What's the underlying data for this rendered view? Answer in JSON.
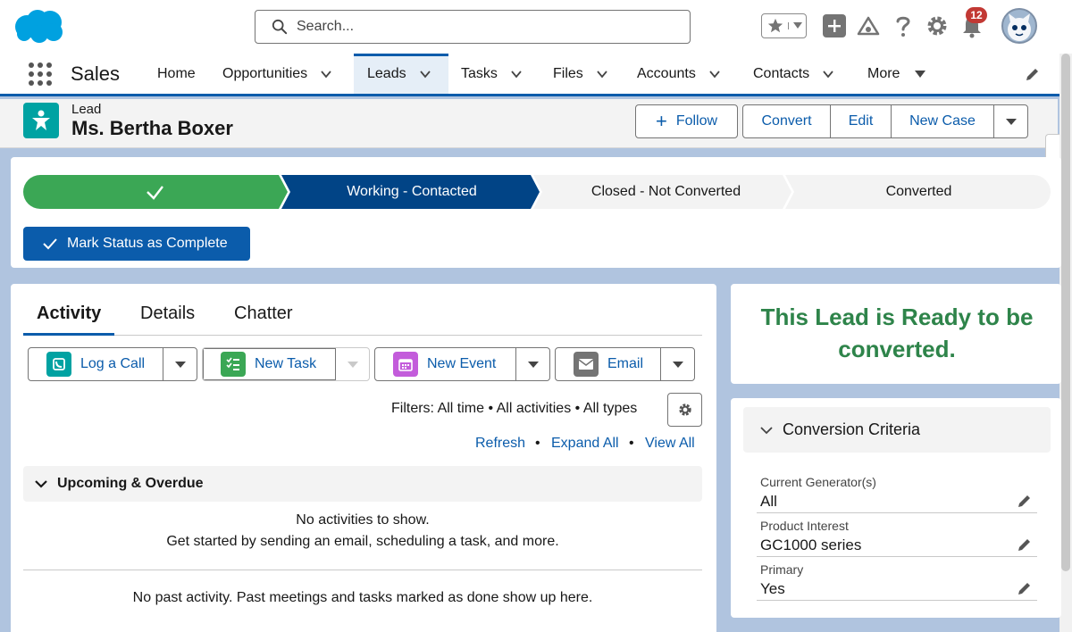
{
  "header": {
    "search_placeholder": "Search...",
    "notification_count": "12"
  },
  "nav": {
    "app_name": "Sales",
    "items": [
      {
        "label": "Home"
      },
      {
        "label": "Opportunities"
      },
      {
        "label": "Leads"
      },
      {
        "label": "Tasks"
      },
      {
        "label": "Files"
      },
      {
        "label": "Accounts"
      },
      {
        "label": "Contacts"
      },
      {
        "label": "More"
      }
    ],
    "active": "Leads"
  },
  "record": {
    "object_label": "Lead",
    "title": "Ms. Bertha Boxer",
    "follow_label": "Follow",
    "actions": [
      "Convert",
      "Edit",
      "New Case"
    ]
  },
  "path": {
    "stages": [
      {
        "label": "",
        "state": "complete"
      },
      {
        "label": "Working - Contacted",
        "state": "current"
      },
      {
        "label": "Closed - Not Converted",
        "state": "incomplete"
      },
      {
        "label": "Converted",
        "state": "incomplete"
      }
    ],
    "mark_button": "Mark Status as Complete"
  },
  "activity": {
    "tabs": [
      "Activity",
      "Details",
      "Chatter"
    ],
    "active_tab": "Activity",
    "buttons": {
      "log_call": "Log a Call",
      "new_task": "New Task",
      "new_event": "New Event",
      "email": "Email"
    },
    "filters": "Filters: All time • All activities • All types",
    "links": {
      "refresh": "Refresh",
      "expand_all": "Expand All",
      "view_all": "View All"
    },
    "upcoming_title": "Upcoming & Overdue",
    "empty_title": "No activities to show.",
    "empty_subtitle": "Get started by sending an email, scheduling a task, and more.",
    "past_text": "No past activity. Past meetings and tasks marked as done show up here."
  },
  "sidebar": {
    "ready_text": "This Lead is Ready to be converted.",
    "criteria_title": "Conversion Criteria",
    "fields": [
      {
        "label": "Current Generator(s)",
        "value": "All"
      },
      {
        "label": "Product Interest",
        "value": "GC1000 series"
      },
      {
        "label": "Primary",
        "value": "Yes"
      }
    ]
  },
  "colors": {
    "brand": "#0b5cab",
    "path_complete": "#3ba755",
    "path_current": "#014486",
    "ready_green": "#2e844a",
    "badge_red": "#c23934"
  }
}
